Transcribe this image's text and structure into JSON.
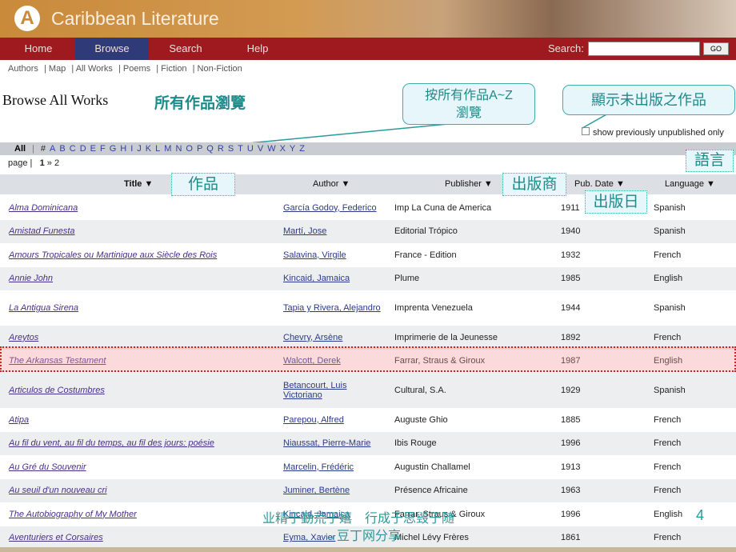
{
  "site": {
    "title": "Caribbean Literature",
    "logo": "A"
  },
  "nav": {
    "tabs": [
      "Home",
      "Browse",
      "Search",
      "Help"
    ],
    "active": "Browse",
    "search_label": "Search:",
    "search_value": "",
    "go": "GO"
  },
  "subnav": [
    "Authors",
    "Map",
    "All Works",
    "Poems",
    "Fiction",
    "Non-Fiction"
  ],
  "heading": "Browse All Works",
  "annotations": {
    "heading_cn": "所有作品瀏覽",
    "az": "按所有作品A~Z",
    "az2": "瀏覽",
    "unpub": "顯示未出版之作品",
    "lang": "語言",
    "title": "作品",
    "publisher": "出版商",
    "date": "出版日"
  },
  "unpublished_label": "show previously unpublished only",
  "alpha": {
    "all": "All",
    "letters": [
      "#",
      "A",
      "B",
      "C",
      "D",
      "E",
      "F",
      "G",
      "H",
      "I",
      "J",
      "K",
      "L",
      "M",
      "N",
      "O",
      "P",
      "Q",
      "R",
      "S",
      "T",
      "U",
      "V",
      "W",
      "X",
      "Y",
      "Z"
    ]
  },
  "paging": {
    "label": "page",
    "current": "1",
    "next": "»",
    "other": "2"
  },
  "columns": [
    "Title ▼",
    "Author ▼",
    "Publisher ▼",
    "Pub. Date ▼",
    "Language ▼"
  ],
  "rows": [
    [
      "Alma Dominicana",
      "García Godoy, Federico",
      "Imp La Cuna de America",
      "1911",
      "Spanish"
    ],
    [
      "Amistad Funesta",
      "Martí, Jose",
      "Editorial Trópico",
      "1940",
      "Spanish"
    ],
    [
      "Amours Tropicales ou Martinique aux Siècle des Rois",
      "Salavina, Virgile",
      "France - Edition",
      "1932",
      "French"
    ],
    [
      "Annie John",
      "Kincaid, Jamaica",
      "Plume",
      "1985",
      "English"
    ],
    [
      "La Antigua Sirena",
      "Tapia y Rivera, Alejandro",
      "Imprenta Venezuela",
      "1944",
      "Spanish"
    ],
    [
      "Areytos",
      "Chevry, Arsène",
      "Imprimerie de la Jeunesse",
      "1892",
      "French"
    ],
    [
      "The Arkansas Testament",
      "Walcott, Derek",
      "Farrar, Straus & Giroux",
      "1987",
      "English"
    ],
    [
      "Articulos de Costumbres",
      "Betancourt, Luis Victoriano",
      "Cultural, S.A.",
      "1929",
      "Spanish"
    ],
    [
      "Atipa",
      "Parepou, Alfred",
      "Auguste Ghio",
      "1885",
      "French"
    ],
    [
      "Au fil du vent, au fil du temps, au fil des jours: poésie",
      "Niaussat, Pierre-Marie",
      "Ibis Rouge",
      "1996",
      "French"
    ],
    [
      "Au Gré du Souvenir",
      "Marcelin, Frédéric",
      "Augustin Challamel",
      "1913",
      "French"
    ],
    [
      "Au seuil d'un nouveau cri",
      "Juminer, Bertène",
      "Présence Africaine",
      "1963",
      "French"
    ],
    [
      "The Autobiography of My Mother",
      "Kincaid, Jamaica",
      "Farrar, Straus & Giroux",
      "1996",
      "English"
    ],
    [
      "Aventuriers et Corsaires",
      "Eyma, Xavier",
      "Michel Lévy Frères",
      "1861",
      "French"
    ]
  ],
  "watermark": {
    "line1": "业精于勤荒于嬉　行成于思毁于随",
    "line2": "→豆丁网分享",
    "page_number": "4"
  }
}
